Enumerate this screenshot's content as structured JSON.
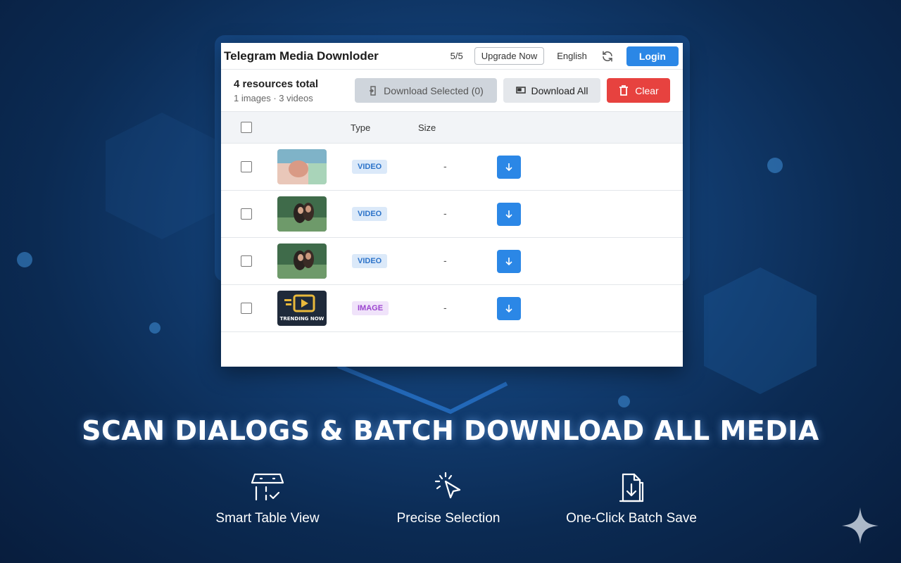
{
  "topbar": {
    "title": "Telegram Media Downloder",
    "quota": "5/5",
    "upgrade_label": "Upgrade Now",
    "language": "English",
    "login_label": "Login"
  },
  "toolbar": {
    "summary_title": "4 resources total",
    "summary_sub": "1 images · 3 videos",
    "download_selected_label": "Download Selected (0)",
    "download_all_label": "Download All",
    "clear_label": "Clear"
  },
  "table": {
    "headers": {
      "type": "Type",
      "size": "Size"
    },
    "rows": [
      {
        "type": "VIDEO",
        "size": "-",
        "thumb": "video-thumbnail-1"
      },
      {
        "type": "VIDEO",
        "size": "-",
        "thumb": "video-thumbnail-2"
      },
      {
        "type": "VIDEO",
        "size": "-",
        "thumb": "video-thumbnail-3"
      },
      {
        "type": "IMAGE",
        "size": "-",
        "thumb": "image-thumbnail-logo",
        "thumb_text": "TRENDING NOW"
      }
    ]
  },
  "headline": "SCAN DIALOGS & BATCH DOWNLOAD ALL MEDIA",
  "features": [
    {
      "label": "Smart Table View",
      "icon": "table-check-icon"
    },
    {
      "label": "Precise Selection",
      "icon": "cursor-click-icon"
    },
    {
      "label": "One-Click Batch Save",
      "icon": "file-download-icon"
    }
  ],
  "colors": {
    "accent": "#2b87e6",
    "danger": "#e7423f",
    "background": "#123e73"
  }
}
